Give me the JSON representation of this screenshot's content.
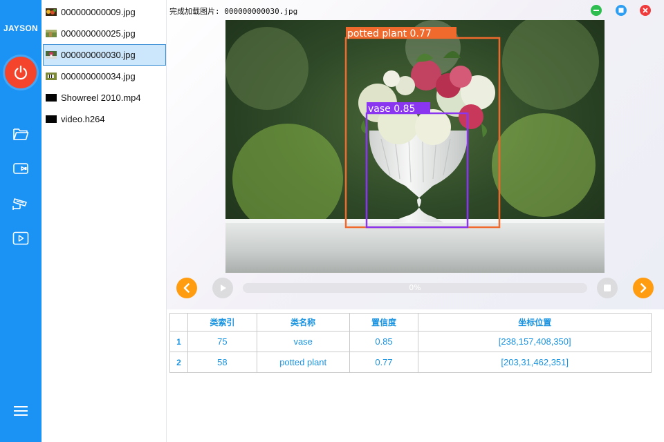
{
  "sidebar": {
    "brand": "JAYSON",
    "icons": [
      "power-icon",
      "folder-icon",
      "camera-icon",
      "cctv-icon",
      "play-video-icon",
      "hamburger-menu-icon"
    ],
    "accent": "#1a93f5",
    "power_color": "#f4452c"
  },
  "files": [
    {
      "name": "000000000009.jpg",
      "thumb": "food-thumbnail"
    },
    {
      "name": "000000000025.jpg",
      "thumb": "giraffe-thumbnail"
    },
    {
      "name": "000000000030.jpg",
      "thumb": "vase-thumbnail",
      "selected": true
    },
    {
      "name": "000000000034.jpg",
      "thumb": "zebra-thumbnail"
    },
    {
      "name": "Showreel 2010.mp4",
      "thumb": "video-thumbnail"
    },
    {
      "name": "video.h264",
      "thumb": "video-thumbnail"
    }
  ],
  "status": "完成加载图片: 000000000030.jpg",
  "window_controls": {
    "minimize": "#2ebd4f",
    "maximize": "#2e9ef2",
    "close": "#ef3b3b"
  },
  "detections": [
    {
      "label": "potted plant 0.77",
      "color": "#f06a2e"
    },
    {
      "label": "vase 0.85",
      "color": "#8a35f0"
    }
  ],
  "player": {
    "progress": 0,
    "progress_label": "0%",
    "prev_color": "#ff9c0f",
    "next_color": "#ff9c0f"
  },
  "table": {
    "headers": [
      "",
      "类索引",
      "类名称",
      "置信度",
      "坐标位置"
    ],
    "rows": [
      [
        "1",
        "75",
        "vase",
        "0.85",
        "[238,157,408,350]"
      ],
      [
        "2",
        "58",
        "potted plant",
        "0.77",
        "[203,31,462,351]"
      ]
    ]
  }
}
